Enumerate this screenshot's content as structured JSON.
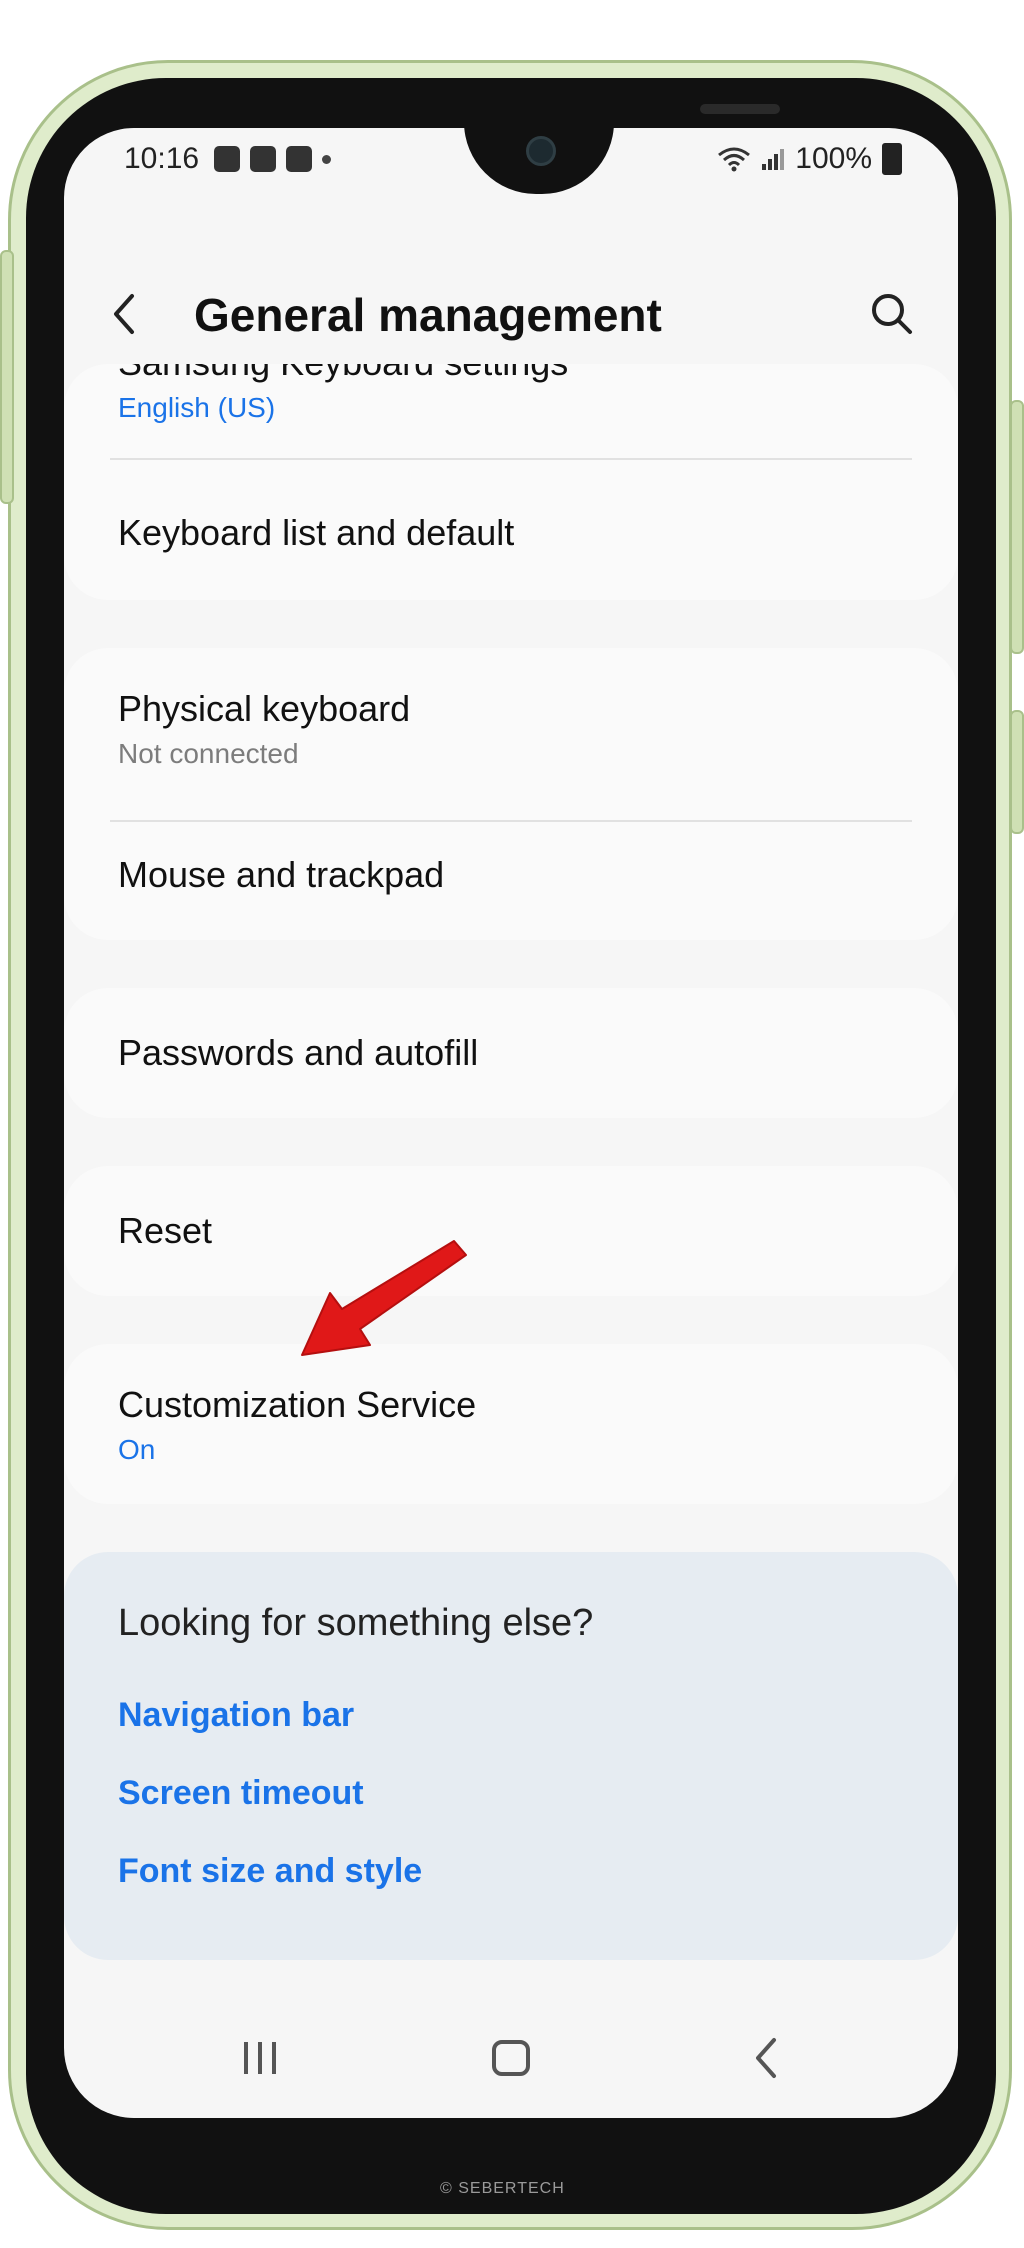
{
  "status_bar": {
    "time": "10:16",
    "battery": "100%"
  },
  "header": {
    "title": "General management"
  },
  "sections": {
    "keyboard": {
      "samsung_keyboard_title": "Samsung Keyboard settings",
      "samsung_keyboard_sub": "English (US)",
      "keyboard_list": "Keyboard list and default"
    },
    "physical": {
      "physical_keyboard_title": "Physical keyboard",
      "physical_keyboard_sub": "Not connected",
      "mouse_trackpad": "Mouse and trackpad"
    },
    "passwords": "Passwords and autofill",
    "reset": "Reset",
    "customization": {
      "title": "Customization Service",
      "sub": "On"
    }
  },
  "suggestions": {
    "heading": "Looking for something else?",
    "links": [
      "Navigation bar",
      "Screen timeout",
      "Font size and style"
    ]
  },
  "watermark": "© SEBERTECH",
  "colors": {
    "accent": "#1a73e8",
    "frame": "#dfeccb",
    "arrow": "#e01818"
  }
}
